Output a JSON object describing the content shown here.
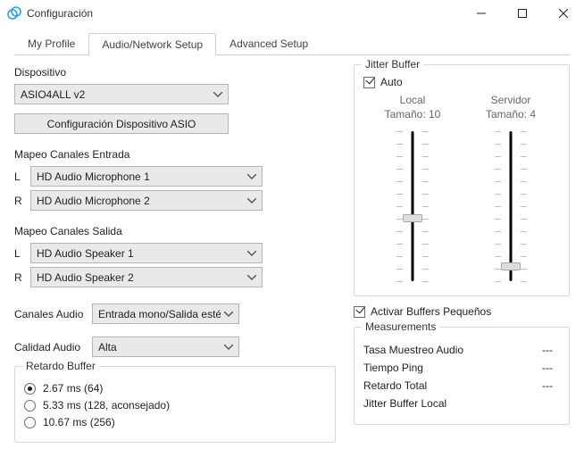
{
  "window": {
    "title": "Configuración"
  },
  "tabs": {
    "profile": "My Profile",
    "audio": "Audio/Network Setup",
    "advanced": "Advanced Setup"
  },
  "device": {
    "label": "Dispositivo",
    "value": "ASIO4ALL v2",
    "asio_button": "Configuración Dispositivo ASIO"
  },
  "input_map": {
    "label": "Mapeo Canales Entrada",
    "l_label": "L",
    "r_label": "R",
    "l_value": "HD Audio Microphone 1",
    "r_value": "HD Audio Microphone 2"
  },
  "output_map": {
    "label": "Mapeo Canales Salida",
    "l_label": "L",
    "r_label": "R",
    "l_value": "HD Audio Speaker 1",
    "r_value": "HD Audio Speaker 2"
  },
  "channels": {
    "label": "Canales Audio",
    "value": "Entrada mono/Salida estéreo"
  },
  "quality": {
    "label": "Calidad Audio",
    "value": "Alta"
  },
  "buffer_delay": {
    "legend": "Retardo Buffer",
    "opt1": "2.67 ms (64)",
    "opt2": "5.33 ms (128, aconsejado)",
    "opt3": "10.67 ms (256)",
    "selected": 1
  },
  "jitter": {
    "legend": "Jitter Buffer",
    "auto_label": "Auto",
    "local_label": "Local",
    "server_label": "Servidor",
    "local_size_label": "Tamaño:",
    "server_size_label": "Tamaño:",
    "local_size": "10",
    "server_size": "4"
  },
  "small_buffers": {
    "label": "Activar Buffers Pequeños"
  },
  "measurements": {
    "legend": "Measurements",
    "sample_rate_label": "Tasa Muestreo Audio",
    "ping_label": "Tiempo Ping",
    "total_delay_label": "Retardo Total",
    "jitter_local_label": "Jitter Buffer Local",
    "sample_rate_val": "---",
    "ping_val": "---",
    "total_delay_val": "---",
    "jitter_local_val": ""
  }
}
